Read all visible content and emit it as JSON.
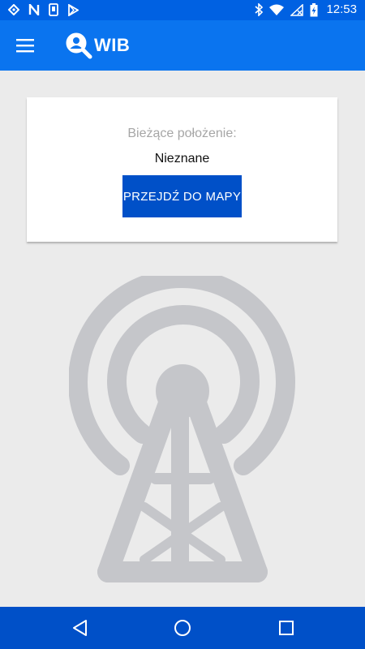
{
  "status_bar": {
    "time": "12:53",
    "left_icons": [
      "navigation-icon",
      "n-notification-icon",
      "phone-icon",
      "play-store-icon"
    ],
    "right_icons": [
      "bluetooth-icon",
      "wifi-icon",
      "no-signal-icon",
      "battery-charging-icon"
    ]
  },
  "app_bar": {
    "title": "WIB",
    "menu_icon": "hamburger-menu-icon",
    "logo_icon": "magnifier-person-icon"
  },
  "location_card": {
    "label": "Bieżące położenie:",
    "value": "Nieznane",
    "button_label": "PRZEJDŹ DO MAPY"
  },
  "illustration": {
    "icon": "radio-tower-icon"
  },
  "nav_bar": {
    "icons": [
      "back-icon",
      "home-icon",
      "recents-icon"
    ]
  },
  "colors": {
    "status_bar": "#0061e2",
    "app_bar": "#0a74ef",
    "nav_bar": "#0050c8",
    "button": "#0050c8",
    "background": "#ebebeb",
    "tower": "#c5c6ca"
  }
}
